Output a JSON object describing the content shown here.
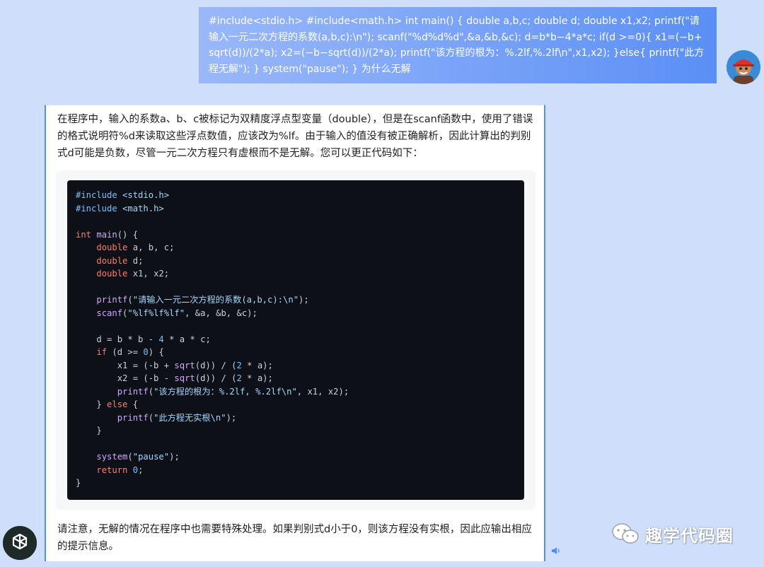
{
  "user_message": {
    "text": "#include<stdio.h> #include<math.h> int main() { double a,b,c; double d; double x1,x2; printf(\"请输入一元二次方程的系数(a,b,c):\\n\"); scanf(\"%d%d%d\",&a,&b,&c); d=b*b−4*a*c; if(d >=0){ x1=(−b+sqrt(d))/(2*a); x2=(−b−sqrt(d))/(2*a); printf(\"该方程的根为：%.2lf,%.2lf\\n\",x1,x2); }else{ printf(\"此方程无解\"); } system(\"pause\"); } 为什么无解"
  },
  "assistant_message": {
    "intro": "在程序中，输入的系数a、b、c被标记为双精度浮点型变量（double），但是在scanf函数中，使用了错误的格式说明符%d来读取这些浮点数值，应该改为%lf。由于输入的值没有被正确解析，因此计算出的判别式d可能是负数，尽管一元二次方程只有虚根而不是无解。您可以更正代码如下：",
    "code_lines": [
      "#include <stdio.h>",
      "#include <math.h>",
      "",
      "int main() {",
      "    double a, b, c;",
      "    double d;",
      "    double x1, x2;",
      "",
      "    printf(\"请输入一元二次方程的系数(a,b,c):\\n\");",
      "    scanf(\"%lf%lf%lf\", &a, &b, &c);",
      "",
      "    d = b * b - 4 * a * c;",
      "    if (d >= 0) {",
      "        x1 = (-b + sqrt(d)) / (2 * a);",
      "        x2 = (-b - sqrt(d)) / (2 * a);",
      "        printf(\"该方程的根为：%.2lf, %.2lf\\n\", x1, x2);",
      "    } else {",
      "        printf(\"此方程无实根\\n\");",
      "    }",
      "",
      "    system(\"pause\");",
      "    return 0;",
      "}"
    ],
    "outro": "请注意，无解的情况在程序中也需要特殊处理。如果判别式d小于0，则该方程没有实根，因此应输出相应的提示信息。"
  },
  "watermark": {
    "text": "趣学代码圈"
  },
  "icons": {
    "user_avatar": "cartoon-avatar-icon",
    "assistant_avatar": "chatgpt-logo-icon",
    "speaker": "speaker-icon",
    "watermark_logo": "wechat-icon"
  },
  "colors": {
    "background": "#cfdffb",
    "user_bubble_start": "#9ab8f9",
    "user_bubble_end": "#5b8ff6",
    "code_bg": "#0d1117",
    "accent_border": "#4f8ff7"
  }
}
